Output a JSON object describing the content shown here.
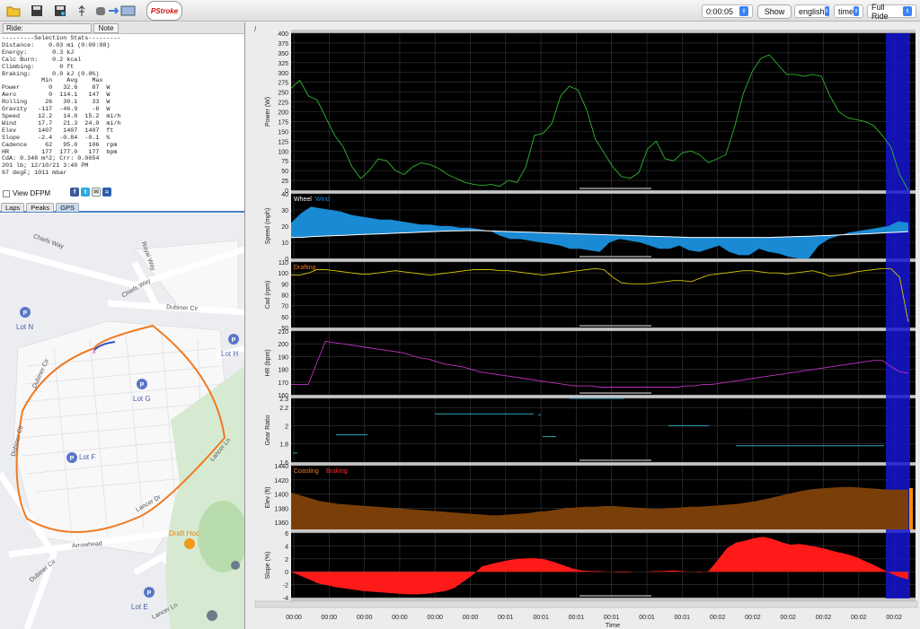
{
  "toolbar": {
    "time_field": "0:00:05",
    "show_label": "Show",
    "units_select": "english",
    "xaxis_select": "time",
    "range_select": "Full Ride",
    "brand": "PStroke"
  },
  "ride": {
    "label": "Ride:",
    "note_label": "Note"
  },
  "stats_text": [
    "---------Selection Stats---------",
    "Distance:    0.03 mi (0:00:08)",
    "Energy:       0.3 kJ",
    "Calc Burn:    0.2 kcal",
    "Climbing:       0 ft",
    "Braking:      0.0 kJ (0.0%)",
    "           Min    Avg    Max",
    "Power        0   32.6    87  W",
    "Aero         0  114.1   147  W",
    "Rolling     26   30.1    33  W",
    "Gravity   -117  -46.9    -6  W",
    "Speed     12.2   14.0  15.2  mi/h",
    "Wind      17.7   21.3  24.0  mi/h",
    "Elev      1407   1407  1407  ft",
    "Slope     -2.4  -0.84  -0.1  %",
    "Cadence     62   95.0   106  rpm",
    "HR         177  177.0   177  bpm",
    "CdA: 0.348 m^2; Crr: 0.0054",
    "201 lb; 12/10/21 3:40 PM",
    "67 degF; 1011 mbar"
  ],
  "view_dfpm": "View DFPM",
  "tabs": [
    "Laps",
    "Peaks",
    "GPS"
  ],
  "map": {
    "streets": [
      "Chiefs Way",
      "Royal Way",
      "Chiefs Way",
      "Dubiner Cir",
      "Dubiner Cir",
      "Dubiner Cir",
      "Dubiner Cir",
      "Lancer Ln",
      "Lancer Ln",
      "Lancer Dr",
      "Arrowhead"
    ],
    "lots": [
      "Lot N",
      "Lot H",
      "Lot G",
      "Lot F",
      "Lot E"
    ],
    "poi": "Draft Hoc"
  },
  "panels": [
    {
      "ylabel": "Power (W)",
      "ticks": [
        "400",
        "375",
        "350",
        "325",
        "300",
        "275",
        "250",
        "225",
        "200",
        "175",
        "150",
        "125",
        "100",
        "75",
        "50",
        "25",
        "0"
      ]
    },
    {
      "ylabel": "Speed (mph)",
      "ticks": [
        "40",
        "30",
        "20",
        "10",
        "0"
      ],
      "legend": [
        "Wheel",
        "Wind"
      ]
    },
    {
      "ylabel": "Cad (rpm)",
      "ticks": [
        "110",
        "100",
        "90",
        "80",
        "70",
        "60",
        "50"
      ],
      "legend": [
        "Drafting"
      ]
    },
    {
      "ylabel": "HR (bpm)",
      "ticks": [
        "210",
        "200",
        "190",
        "180",
        "170",
        "160"
      ]
    },
    {
      "ylabel": "Gear Ratio",
      "ticks": [
        "2.3",
        "2.2",
        "2",
        "1.8",
        "1.6"
      ]
    },
    {
      "ylabel": "Elev (ft)",
      "ticks": [
        "1440",
        "1420",
        "1400",
        "1380",
        "1360"
      ],
      "legend": [
        "Coasting",
        "Braking"
      ]
    },
    {
      "ylabel": "Slope (%)",
      "ticks": [
        "6",
        "4",
        "2",
        "0",
        "-2",
        "-4"
      ]
    }
  ],
  "xticks": [
    "00:00",
    "00:00",
    "00:00",
    "00:00",
    "00:00",
    "00:00",
    "00:01",
    "00:01",
    "00:01",
    "00:01",
    "00:01",
    "00:01",
    "00:02",
    "00:02",
    "00:02",
    "00:02",
    "00:02",
    "00:02"
  ],
  "xlabel": "Time",
  "colors": {
    "power": "#2db52d",
    "speed": "#1a8ad4",
    "cad": "#d6c600",
    "hr": "#c030c0",
    "gear": "#2aa6b8",
    "elev": "#7a3f08",
    "slope": "#ff1a1a",
    "selection": "#1515d0"
  }
}
